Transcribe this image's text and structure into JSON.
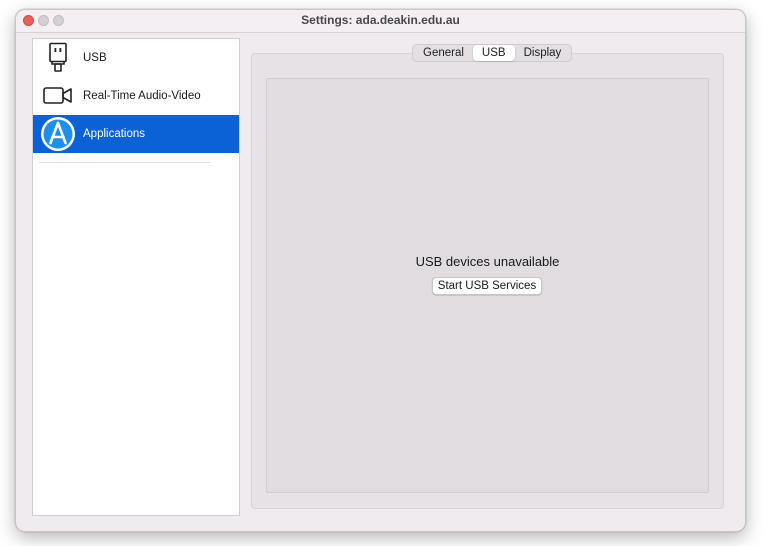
{
  "window": {
    "title": "Settings: ada.deakin.edu.au"
  },
  "sidebar": {
    "items": [
      {
        "label": "USB",
        "icon": "usb-icon",
        "selected": false
      },
      {
        "label": "Real-Time Audio-Video",
        "icon": "video-camera-icon",
        "selected": false
      },
      {
        "label": "Applications",
        "icon": "applications-icon",
        "selected": true
      }
    ]
  },
  "tabs": [
    {
      "label": "General",
      "active": false
    },
    {
      "label": "USB",
      "active": true
    },
    {
      "label": "Display",
      "active": false
    }
  ],
  "usb_panel": {
    "message": "USB devices unavailable",
    "start_button_label": "Start USB Services"
  },
  "colors": {
    "selection": "#0a62d6",
    "close_button": "#ec5f56",
    "window_background": "#efebef"
  }
}
